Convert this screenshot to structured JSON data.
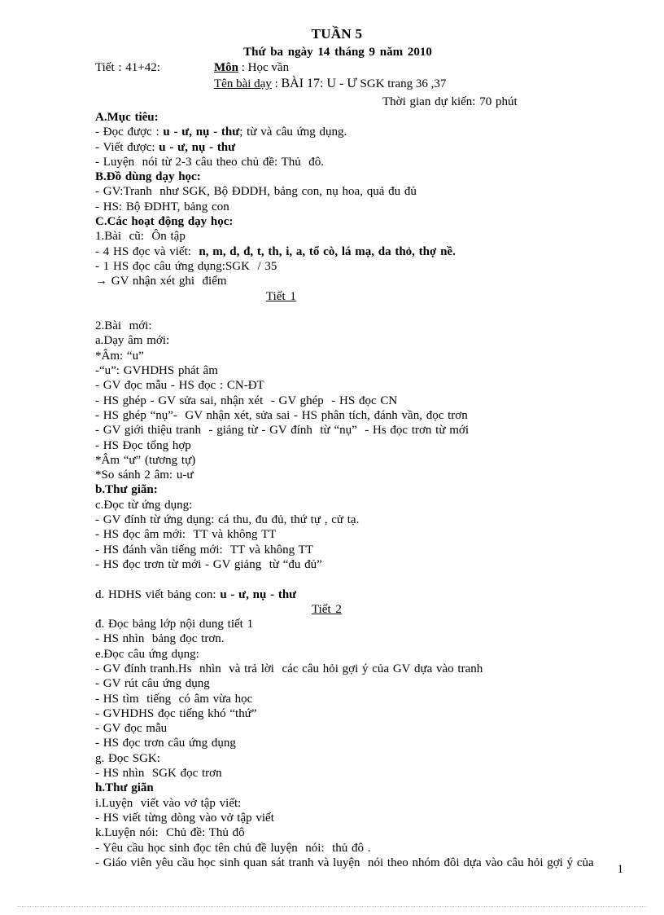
{
  "header": {
    "title": "TUẦN 5",
    "date": "Thứ  ba ngày 14 tháng  9  năm  2010",
    "tiet_label": "Tiết : 41+42:",
    "mon_label": "Môn",
    "mon_value": " : Học vần",
    "ten_bai_day_label": "Tên bài dạy",
    "ten_bai_day_sep": " : ",
    "ten_bai_day_value": "BÀI 17: U - Ư",
    "ten_bai_day_sgk": "  SGK trang 36 ,37",
    "thoi_gian": "Thời  gian  dự kiến:  70 phút"
  },
  "section_a": {
    "heading": "A.Mục tiêu:",
    "lines": [
      {
        "text": "- Đọc được : ",
        "bold_text": "u - ư, nụ - thư",
        "tail": "; từ và câu ứng dụng."
      },
      {
        "text": "- Viết được: ",
        "bold_text": "u - ư, nụ - thư",
        "tail": ""
      },
      {
        "text": "- Luyện  nói từ 2-3 câu theo chủ đề: Thủ  đô.",
        "bold_text": "",
        "tail": ""
      }
    ]
  },
  "section_b": {
    "heading": "B.Đồ dùng dạy học:",
    "lines": [
      "- GV:Tranh  như SGK, Bộ ĐDDH, bảng con, nụ hoa, quả đu đủ",
      "- HS: Bộ ĐDHT, bảng con"
    ]
  },
  "section_c": {
    "heading": "C.Các hoạt động dạy học:",
    "lines": [
      {
        "text": "1.Bài  cũ:  Ôn tập",
        "bold_text": "",
        "tail": ""
      },
      {
        "text": "- 4 HS đọc và viết:  ",
        "bold_text": "n, m, d, đ, t, th, i, a, tổ cò, lá mạ, da thỏ, thợ nề.",
        "tail": ""
      },
      {
        "text": "- 1 HS đọc câu ứng dụng:SGK  / 35",
        "bold_text": "",
        "tail": ""
      },
      {
        "text": "→ GV nhận xét ghi  điểm",
        "bold_text": "",
        "tail": ""
      }
    ]
  },
  "tiet1_marker": "Tiết 1",
  "tiet2_marker": "Tiết 2",
  "lesson_part1": [
    {
      "text": "2.Bài  mới:",
      "style": "normal"
    },
    {
      "text": "a.Dạy âm mới:",
      "style": "normal"
    },
    {
      "text": "*Âm: “u”",
      "style": "normal"
    },
    {
      "text": "-“u”: GVHDHS phát âm",
      "style": "normal"
    },
    {
      "text": "- GV đọc mẫu - HS đọc : CN-ĐT",
      "style": "normal"
    },
    {
      "text": "- HS ghép - GV sửa sai, nhận xét  - GV ghép  - HS đọc CN",
      "style": "normal"
    },
    {
      "text": "- HS ghép “nụ”-  GV nhận xét, sửa sai - HS phân tích, đánh vần, đọc trơn",
      "style": "normal"
    },
    {
      "text": "- GV giới thiệu tranh  - giảng từ - GV đính  từ “nụ”  - Hs đọc trơn từ mới",
      "style": "normal"
    },
    {
      "text": "- HS Đọc tổng hợp",
      "style": "normal"
    },
    {
      "text": "*Âm “ư” (tương tự)",
      "style": "normal"
    },
    {
      "text": "*So sánh 2 âm: u-ư",
      "style": "normal"
    },
    {
      "text": "b.Thư giãn:",
      "style": "bold"
    },
    {
      "text": "c.Đọc từ ứng dụng:",
      "style": "normal"
    },
    {
      "text": "- GV đính từ ứng dụng: cá thu, đu đủ, thứ tự , cử tạ.",
      "style": "normal"
    },
    {
      "text": "- HS đọc âm mới:  TT và không TT",
      "style": "normal"
    },
    {
      "text": "- HS đánh vần tiếng mới:  TT và không TT",
      "style": "normal"
    },
    {
      "text": "- HS đọc trơn từ mới - GV giảng  từ “đu đủ”",
      "style": "normal"
    },
    {
      "text": "",
      "style": "blank"
    }
  ],
  "hdhs_line": {
    "text": "d. HDHS viết bảng con: ",
    "bold_text": "u - ư, nụ - thư"
  },
  "lesson_part2": [
    {
      "text": "đ. Đọc bảng lớp nội dung tiết 1",
      "style": "normal"
    },
    {
      "text": "- HS nhìn  bảng đọc trơn.",
      "style": "normal"
    },
    {
      "text": "e.Đọc câu ứng dụng:",
      "style": "normal"
    },
    {
      "text": "- GV đính tranh.Hs  nhìn  và trả lời  các câu hỏi gợi ý của GV dựa vào tranh",
      "style": "normal"
    },
    {
      "text": "- GV rút câu ứng dụng",
      "style": "normal"
    },
    {
      "text": "- HS tìm  tiếng  có âm vừa học",
      "style": "normal"
    },
    {
      "text": "- GVHDHS đọc tiếng khó “thứ”",
      "style": "normal"
    },
    {
      "text": "- GV đọc mẫu",
      "style": "normal"
    },
    {
      "text": "- HS đọc trơn câu ứng dụng",
      "style": "normal"
    },
    {
      "text": "g. Đọc SGK:",
      "style": "normal"
    },
    {
      "text": "- HS nhìn  SGK đọc trơn",
      "style": "normal"
    },
    {
      "text": "h.Thư giãn",
      "style": "bold"
    },
    {
      "text": "i.Luyện  viết vào vở tập viết:",
      "style": "normal"
    },
    {
      "text": "- HS viết từng dòng vào vở tập viết",
      "style": "normal"
    },
    {
      "text": "k.Luyện nói:  Chủ đề: Thủ đô",
      "style": "normal"
    },
    {
      "text": "- Yêu cầu học sinh đọc tên chủ đề luyện  nói:  thủ đô .",
      "style": "normal"
    },
    {
      "text": "- Giáo viên yêu cầu học sinh quan sát tranh và luyện  nói theo nhóm đôi dựa vào câu hỏi gợi ý của",
      "style": "normal"
    }
  ],
  "footer": {
    "page_number": "1"
  }
}
